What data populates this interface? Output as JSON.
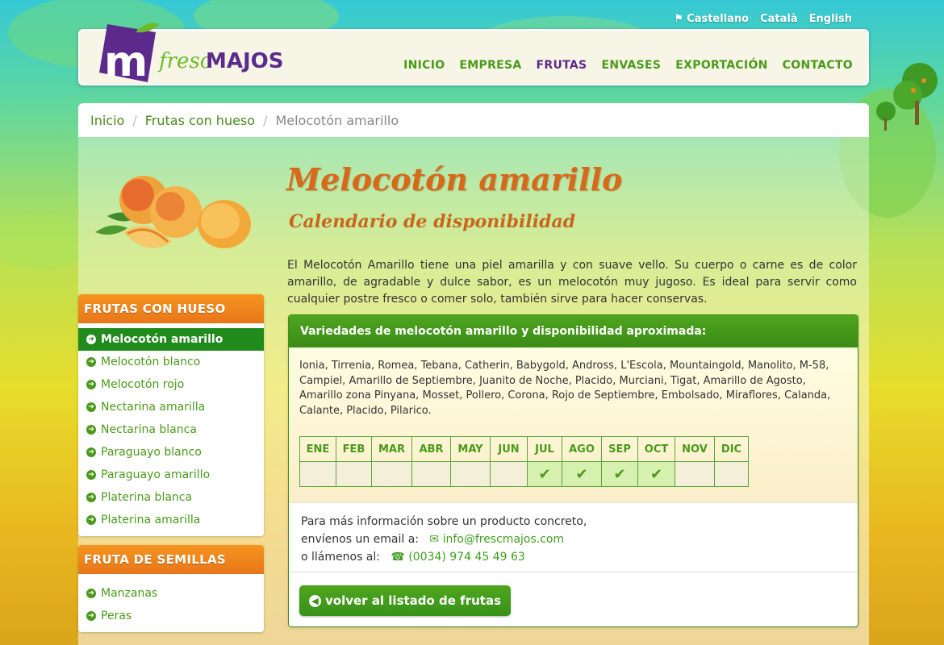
{
  "languages": [
    {
      "label": "Castellano",
      "active": true
    },
    {
      "label": "Català"
    },
    {
      "label": "English"
    }
  ],
  "brand": {
    "name_part1": "fresc",
    "name_part2": "MAJOS"
  },
  "nav": [
    {
      "label": "INICIO"
    },
    {
      "label": "EMPRESA"
    },
    {
      "label": "FRUTAS",
      "active": true
    },
    {
      "label": "ENVASES"
    },
    {
      "label": "EXPORTACIÓN"
    },
    {
      "label": "CONTACTO"
    }
  ],
  "breadcrumb": {
    "home": "Inicio",
    "section": "Frutas con hueso",
    "current": "Melocotón amarillo"
  },
  "sidebar": {
    "stone_heading": "FRUTAS CON HUESO",
    "stone_items": [
      {
        "label": "Melocotón amarillo",
        "active": true
      },
      {
        "label": "Melocotón blanco"
      },
      {
        "label": "Melocotón rojo"
      },
      {
        "label": "Nectarina amarilla"
      },
      {
        "label": "Nectarina blanca"
      },
      {
        "label": "Paraguayo blanco"
      },
      {
        "label": "Paraguayo amarillo"
      },
      {
        "label": "Platerina blanca"
      },
      {
        "label": "Platerina amarilla"
      }
    ],
    "seed_heading": "FRUTA DE SEMILLAS",
    "seed_items": [
      {
        "label": "Manzanas"
      },
      {
        "label": "Peras"
      }
    ]
  },
  "content": {
    "title": "Melocotón amarillo",
    "subtitle": "Calendario de disponibilidad",
    "description": "El Melocotón Amarillo tiene una piel amarilla y con suave vello. Su cuerpo o carne es de color amarillo, de agradable y dulce sabor, es un melocotón muy jugoso. Es ideal para servir como cualquier postre fresco o comer solo, también sirve para hacer conservas.",
    "card_heading": "Variedades de melocotón amarillo y disponibilidad aproximada:",
    "varieties": "Ionia, Tirrenia, Romea, Tebana, Catherin, Babygold, Andross, L'Escola, Mountaingold, Manolito, M-58, Campiel, Amarillo de Septiembre, Juanito de Noche, Placido, Murciani, Tigat, Amarillo de Agosto, Amarillo zona Pinyana, Mosset, Pollero, Corona, Rojo de Septiembre, Embolsado, Miraflores, Calanda, Calante, Placido, Pilarico.",
    "months": [
      "ENE",
      "FEB",
      "MAR",
      "ABR",
      "MAY",
      "JUN",
      "JUL",
      "AGO",
      "SEP",
      "OCT",
      "NOV",
      "DIC"
    ],
    "available": [
      false,
      false,
      false,
      false,
      false,
      false,
      true,
      true,
      true,
      true,
      false,
      false
    ],
    "contact_line1": "Para más información sobre un producto concreto,",
    "contact_line2": "envíenos un email a:",
    "email": "info@frescmajos.com",
    "contact_line3": "o llámenos al:",
    "phone": "(0034) 974 45 49 63",
    "back_button": "volver al listado de frutas"
  },
  "colors": {
    "brand_green": "#4a9a1a",
    "brand_purple": "#5b2a8c",
    "accent_orange": "#e8761a"
  }
}
